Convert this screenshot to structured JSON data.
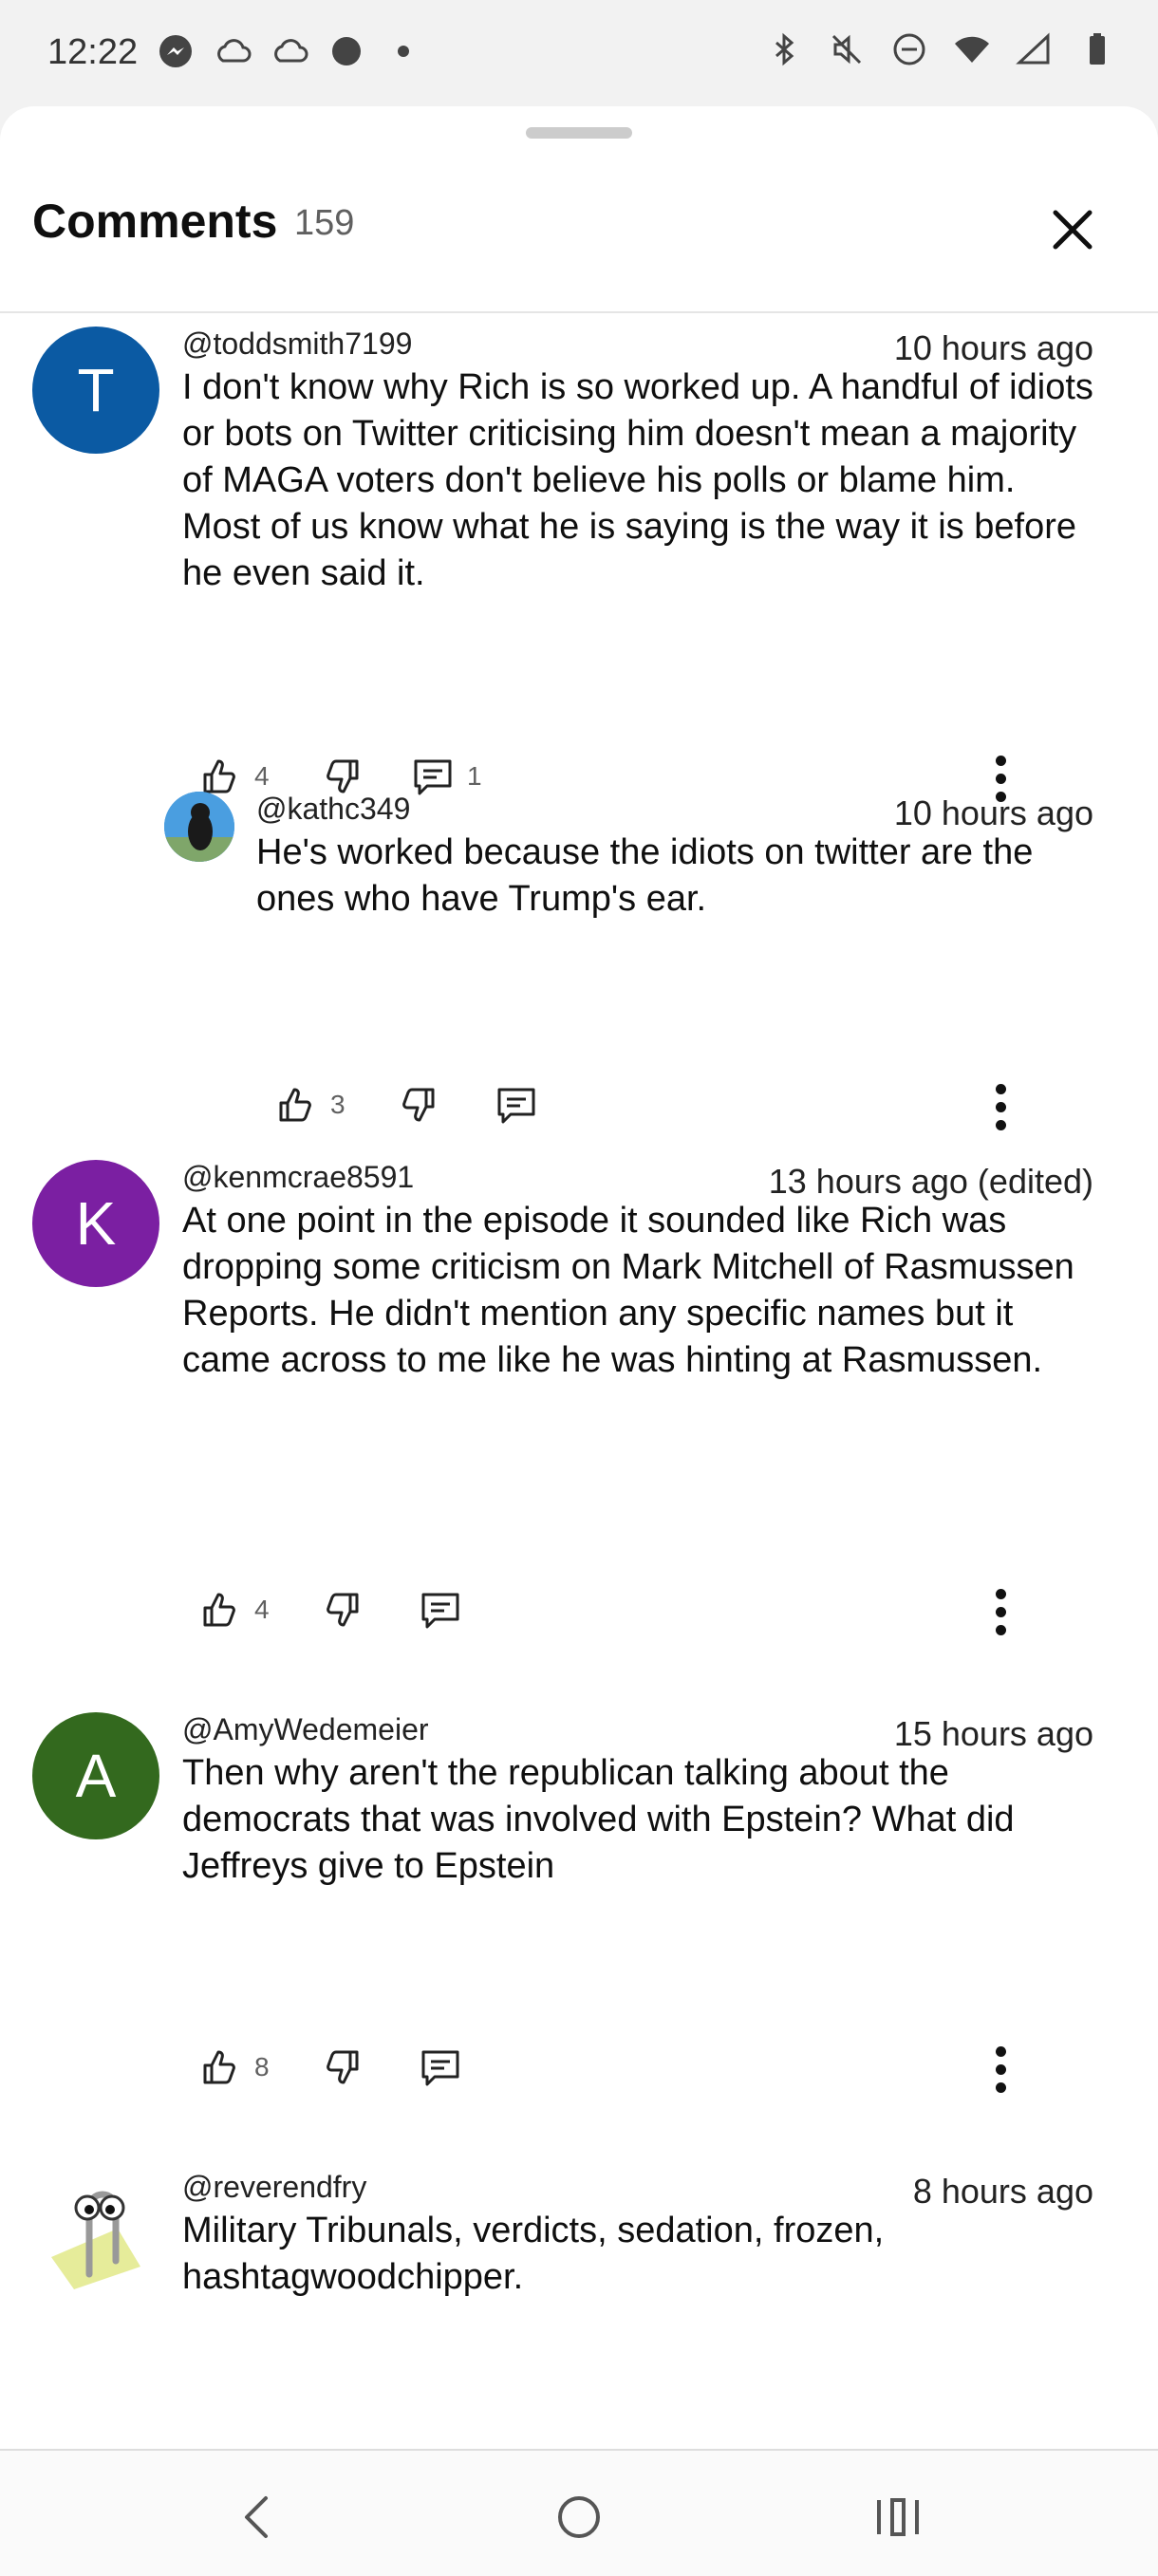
{
  "status_bar": {
    "time": "12:22",
    "left_icons": [
      "messenger-icon",
      "cloud-icon",
      "cloud-icon",
      "dot-icon",
      "small-dot-icon"
    ],
    "right_icons": [
      "bluetooth-icon",
      "mute-icon",
      "dnd-icon",
      "wifi-icon",
      "signal-icon",
      "battery-icon"
    ]
  },
  "header": {
    "title": "Comments",
    "count": "159"
  },
  "comments": [
    {
      "avatar_letter": "T",
      "avatar_color": "#0b5aa3",
      "author": "@toddsmith7199",
      "time": "10 hours ago",
      "text": "I don't know why Rich is so worked up. A handful of idiots or bots on Twitter criticising him doesn't mean a majority of MAGA voters don't believe his polls or blame him. Most of us know what he is saying is the way it is before he even said it.",
      "likes": "4",
      "replies": "1"
    },
    {
      "avatar_letter": "",
      "avatar_color": "#3a8fd6",
      "author": "@kathc349",
      "time": "10 hours ago",
      "text": "He's worked because the idiots on twitter are the ones who have Trump's ear.",
      "likes": "3",
      "replies": ""
    },
    {
      "avatar_letter": "K",
      "avatar_color": "#7b1fa2",
      "author": "@kenmcrae8591",
      "time": "13 hours ago (edited)",
      "text": "At one point in the episode it sounded like Rich was dropping some criticism on Mark Mitchell of Rasmussen Reports. He didn't  mention any specific names but it came across to me like he was hinting at Rasmussen.",
      "likes": "4",
      "replies": ""
    },
    {
      "avatar_letter": "A",
      "avatar_color": "#33691e",
      "author": "@AmyWedemeier",
      "time": "15 hours ago",
      "text": "Then why aren't the republican talking about the democrats that was involved with Epstein? What did Jeffreys give to Epstein",
      "likes": "8",
      "replies": ""
    },
    {
      "avatar_letter": "",
      "avatar_color": "#ffffff",
      "author": "@reverendfry",
      "time": "8 hours ago",
      "text": "Military Tribunals, verdicts, sedation, frozen, hashtagwoodchipper.",
      "likes": "",
      "replies": ""
    }
  ],
  "nav_bar": {
    "buttons": [
      "back-icon",
      "home-icon",
      "recents-icon"
    ]
  }
}
